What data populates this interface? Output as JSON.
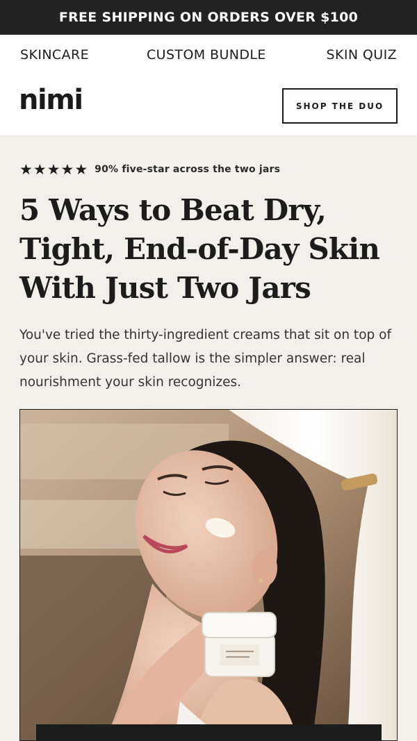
{
  "announcement": "FREE SHIPPING ON ORDERS OVER $100",
  "nav": {
    "items": [
      "SKINCARE",
      "CUSTOM BUNDLE",
      "SKIN QUIZ"
    ]
  },
  "brand": {
    "logo": "nimi"
  },
  "header": {
    "cta_label": "SHOP THE DUO"
  },
  "rating": {
    "stars": 5,
    "star_glyph": "★",
    "text": "90% five-star across the two jars"
  },
  "article": {
    "headline": "5 Ways to Beat Dry, Tight, End-of-Day Skin With Just Two Jars",
    "intro": "You've tried the thirty-ingredient creams that sit on top of your skin. Grass-fed tallow is the simpler answer: real nourishment your skin recognizes."
  },
  "colors": {
    "announcement_bg": "#222222",
    "page_bg": "#f3f0eb",
    "text": "#1c1c1c"
  }
}
